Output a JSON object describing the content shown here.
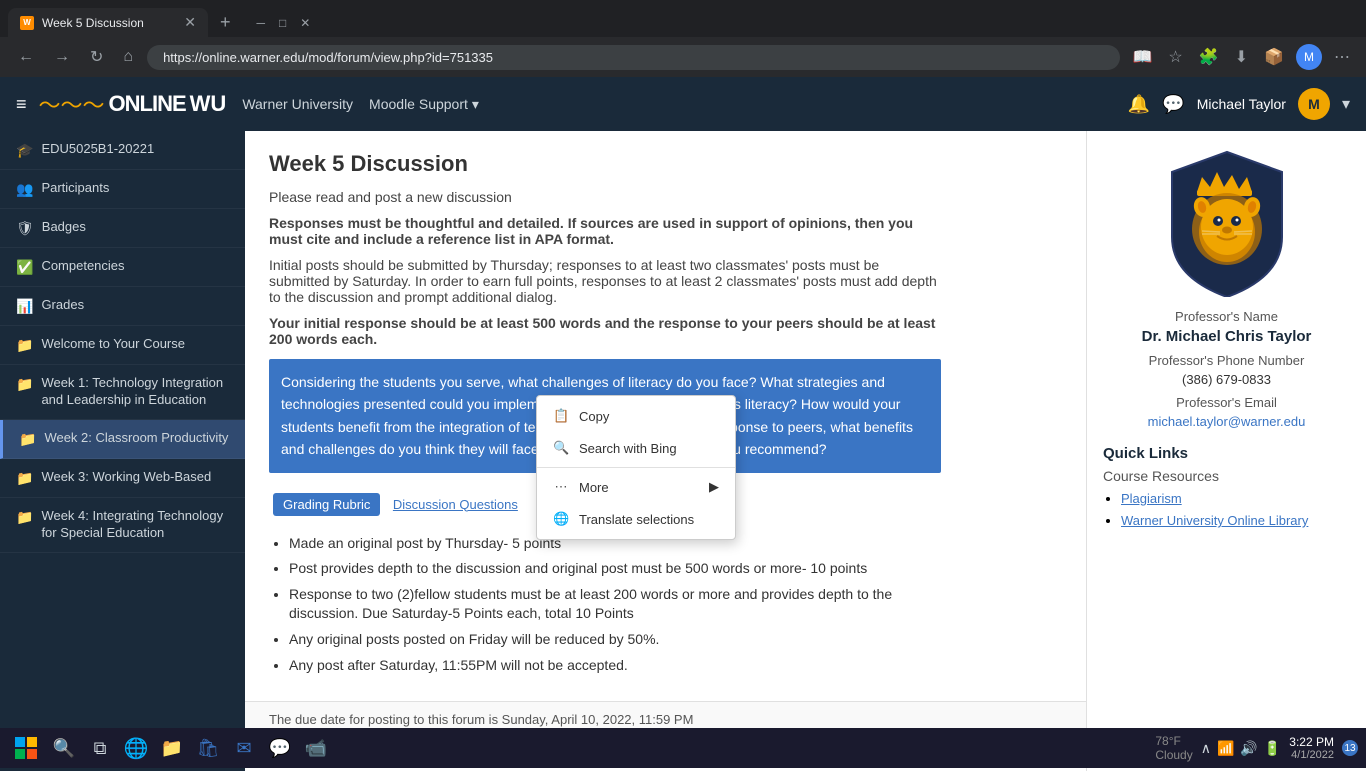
{
  "browser": {
    "tab_title": "Week 5 Discussion",
    "tab_favicon": "W",
    "url": "https://online.warner.edu/mod/forum/view.php?id=751335",
    "new_tab_label": "+",
    "nav_back": "←",
    "nav_forward": "→",
    "nav_refresh": "↻",
    "nav_home": "⌂"
  },
  "header": {
    "hamburger": "≡",
    "logo_prefix": "WU",
    "logo_main": "ONLINE",
    "logo_suffix": "WU",
    "nav_university": "Warner University",
    "nav_moodle": "Moodle Support",
    "nav_moodle_arrow": "▾",
    "bell_icon": "🔔",
    "message_icon": "💬",
    "user_name": "Michael Taylor",
    "user_avatar_text": "M",
    "dropdown_arrow": "▾"
  },
  "sidebar": {
    "items": [
      {
        "id": "course-id",
        "icon": "🎓",
        "label": "EDU5025B1-20221"
      },
      {
        "id": "participants",
        "icon": "👥",
        "label": "Participants"
      },
      {
        "id": "badges",
        "icon": "🛡",
        "label": "Badges"
      },
      {
        "id": "competencies",
        "icon": "✅",
        "label": "Competencies"
      },
      {
        "id": "grades",
        "icon": "📊",
        "label": "Grades"
      },
      {
        "id": "welcome",
        "icon": "📁",
        "label": "Welcome to Your Course"
      },
      {
        "id": "week1",
        "icon": "📁",
        "label": "Week 1: Technology Integration and Leadership in Education"
      },
      {
        "id": "week2",
        "icon": "📁",
        "label": "Week 2: Classroom Productivity",
        "active": true
      },
      {
        "id": "week3",
        "icon": "📁",
        "label": "Week 3: Working Web-Based"
      },
      {
        "id": "week4",
        "icon": "📁",
        "label": "Week 4: Integrating Technology for Special Education"
      }
    ]
  },
  "content": {
    "page_title": "Week 5 Discussion",
    "intro_text": "Please read and post a new discussion",
    "para1": "Responses must be thoughtful and detailed.  If sources are used in support of opinions, then you must cite and include a reference list in APA format.",
    "para2": "Initial posts should be submitted by Thursday; responses to at least two classmates' posts must be submitted by Saturday.  In order to earn full points, responses to at least 2 classmates' posts must add depth to the discussion and prompt additional dialog.",
    "para3": "Your initial response should be at least 500 words and the response to your peers should be at least 200 words each.",
    "highlighted_question": "Considering the students you serve, what challenges of literacy do you face? What strategies and technologies presented could you implement in your classroom to address literacy? How would your students benefit from the integration of technology and strategies? In response to peers, what benefits and challenges do you think they will face? What other resource could you recommend?",
    "grading_rubric_label": "Grading Rubric",
    "discussion_questions_label": "Discussion Questions",
    "bullets": [
      "Made an original post by Thursday- 5 points",
      "Post provides depth to the discussion and original post must be 500 words or more- 10 points",
      "Response to  two (2)fellow students must be at least 200 words or more and provides depth to the discussion. Due Saturday-5 Points each, total 10 Points",
      "Any original posts posted on Friday will be reduced by 50%.",
      "Any post after Saturday, 11:55PM will not be accepted."
    ],
    "due_date_text": "The due date for posting to this forum is Sunday, April 10, 2022, 11:59 PM"
  },
  "context_menu": {
    "items": [
      {
        "id": "copy",
        "icon": "📋",
        "label": "Copy"
      },
      {
        "id": "search-bing",
        "icon": "🔍",
        "label": "Search with Bing"
      },
      {
        "id": "more",
        "icon": "...",
        "label": "More",
        "has_arrow": true
      },
      {
        "id": "translate",
        "icon": "🌐",
        "label": "Translate selections",
        "has_arrow": false
      }
    ]
  },
  "right_panel": {
    "professor_label": "Professor's Name",
    "professor_name": "Dr. Michael Chris Taylor",
    "phone_label": "Professor's Phone Number",
    "phone_value": "(386) 679-0833",
    "email_label": "Professor's Email",
    "email_value": "michael.taylor@warner.edu",
    "quick_links_title": "Quick Links",
    "course_resources_title": "Course Resources",
    "resources": [
      {
        "id": "plagiarism",
        "label": "Plagiarism"
      },
      {
        "id": "wuol",
        "label": "Warner University Online Library"
      }
    ]
  },
  "taskbar": {
    "time": "3:22 PM",
    "date": "4/1/2022",
    "notification_count": "13",
    "weather": "78°F",
    "weather_condition": "Cloudy"
  }
}
